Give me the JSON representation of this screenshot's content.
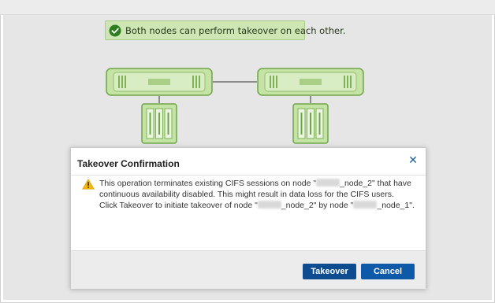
{
  "banner": {
    "text": "Both nodes can perform takeover on each other.",
    "icon": "check-circle-icon",
    "color": "#cde6b3"
  },
  "topology": {
    "nodes": [
      "node-1",
      "node-2"
    ],
    "node_color": "#c6e3a6",
    "node_border": "#6ea54a"
  },
  "dialog": {
    "title": "Takeover Confirmation",
    "close_icon": "close-icon",
    "warning_icon": "warning-icon",
    "message_line1_pre": "This operation terminates existing CIFS sessions on node \"",
    "message_line1_post": "_node_2\" that have",
    "message_line2": "continuous availability disabled. This might result in data loss for the CIFS users.",
    "message_line3_pre": "Click Takeover to initiate takeover of node \"",
    "message_line3_mid": "_node_2\" by node \"",
    "message_line3_post": "_node_1\".",
    "buttons": {
      "takeover": "Takeover",
      "cancel": "Cancel"
    },
    "accent": "#0c4c8f"
  }
}
